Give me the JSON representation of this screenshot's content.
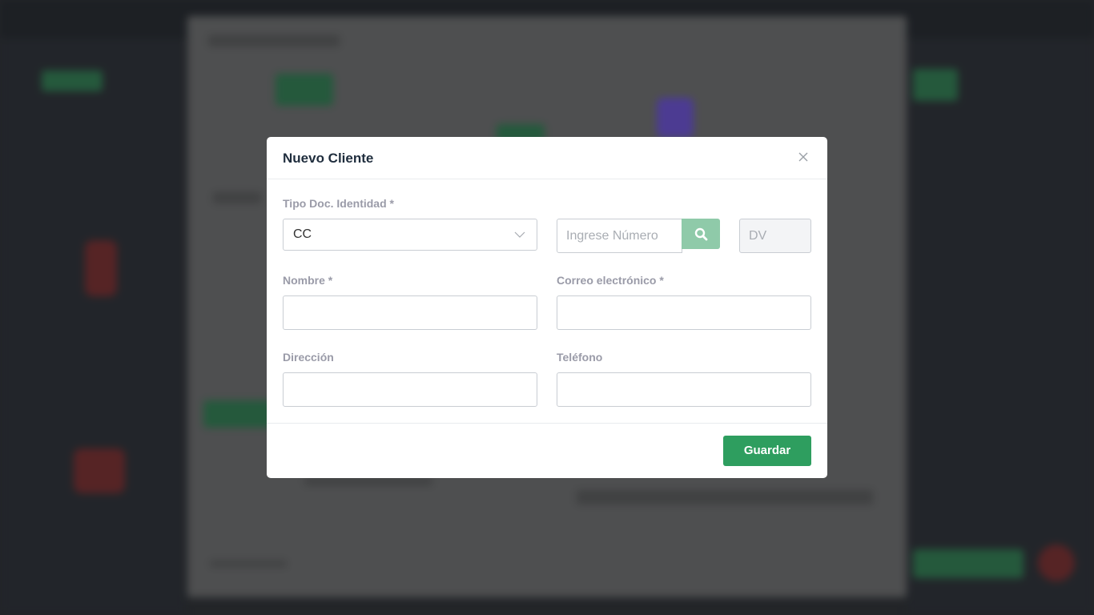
{
  "modal": {
    "title": "Nuevo Cliente",
    "close_icon": "close-icon"
  },
  "form": {
    "doc_type": {
      "label": "Tipo Doc. Identidad *",
      "value": "CC"
    },
    "doc_number": {
      "placeholder": "Ingrese Número",
      "value": ""
    },
    "search_icon": "search-icon",
    "dv": {
      "placeholder": "DV",
      "value": ""
    },
    "name": {
      "label": "Nombre *",
      "value": ""
    },
    "email": {
      "label": "Correo electrónico *",
      "value": ""
    },
    "address": {
      "label": "Dirección",
      "value": ""
    },
    "phone": {
      "label": "Teléfono",
      "value": ""
    }
  },
  "footer": {
    "save_label": "Guardar"
  },
  "colors": {
    "primary_green": "#2e9e5f",
    "search_button": "#8fcaa9",
    "label_gray": "#9a9ba8"
  }
}
